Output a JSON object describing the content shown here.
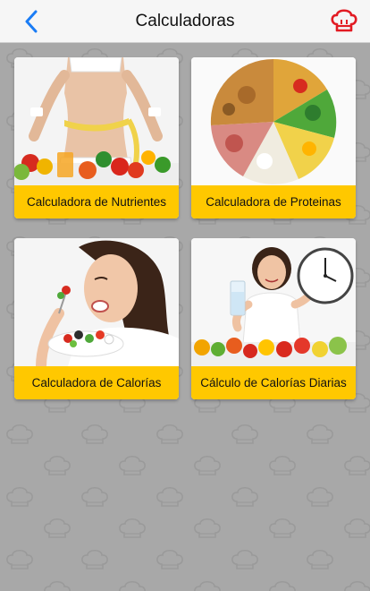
{
  "navbar": {
    "title": "Calculadoras",
    "back_icon": "chevron-left-icon",
    "chef_icon": "chef-hat-icon",
    "accent_color": "#1a7cf5",
    "chef_color": "#e21b23"
  },
  "theme": {
    "background": "#a8a8a8",
    "card_label_bg": "#ffc800"
  },
  "cards": [
    {
      "label": "Calculadora de Nutrientes",
      "image": "woman-measuring-waist-with-fruits"
    },
    {
      "label": "Calculadora de Proteinas",
      "image": "food-groups-circle"
    },
    {
      "label": "Calculadora de Calorías",
      "image": "woman-eating-salad"
    },
    {
      "label": "Cálculo de Calorías Diarias",
      "image": "woman-with-water-and-clock"
    }
  ]
}
